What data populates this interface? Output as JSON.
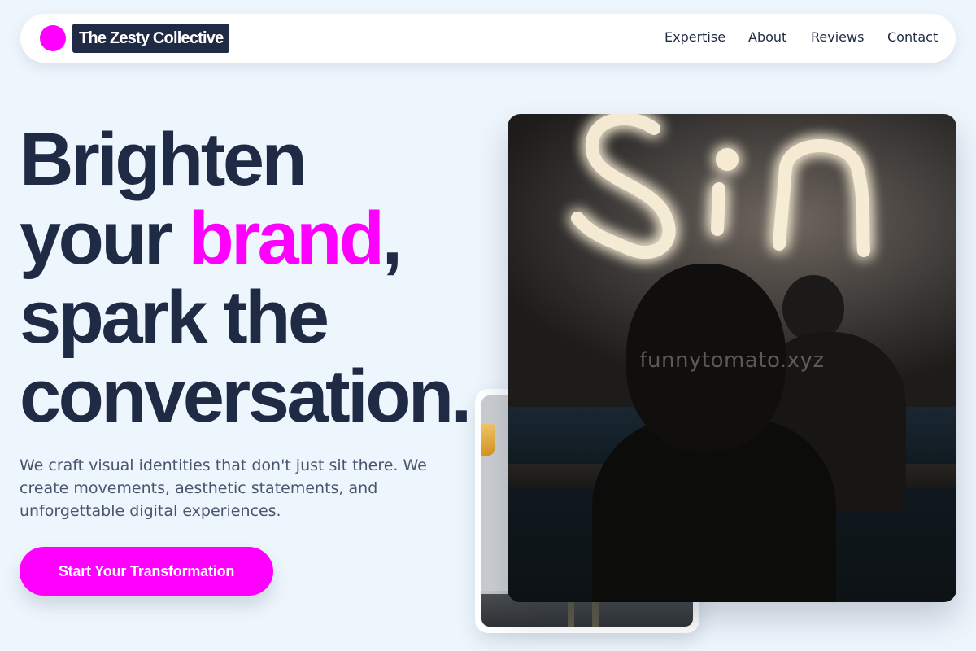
{
  "brand": {
    "name": "The Zesty Collective",
    "accent_color": "#ff00ff",
    "dark_color": "#1f2a44"
  },
  "nav": {
    "links": [
      "Expertise",
      "About",
      "Reviews",
      "Contact"
    ]
  },
  "hero": {
    "headline": {
      "line1": "Brighten",
      "line2_before": "your ",
      "line2_accent": "brand",
      "line2_after": ",",
      "line3": "spark the",
      "line4": "conversation."
    },
    "subtext": "We craft visual identities that don't just sit there. We create movements, aesthetic statements, and unforgettable digital experiences.",
    "cta_label": "Start Your Transformation"
  },
  "images": {
    "main_photo": {
      "subject": "neon sign reading Sin above silhouetted people",
      "watermark_text": "funnytomato.xyz"
    },
    "secondary_photo": {
      "subject": "light interior with drink glass"
    }
  }
}
